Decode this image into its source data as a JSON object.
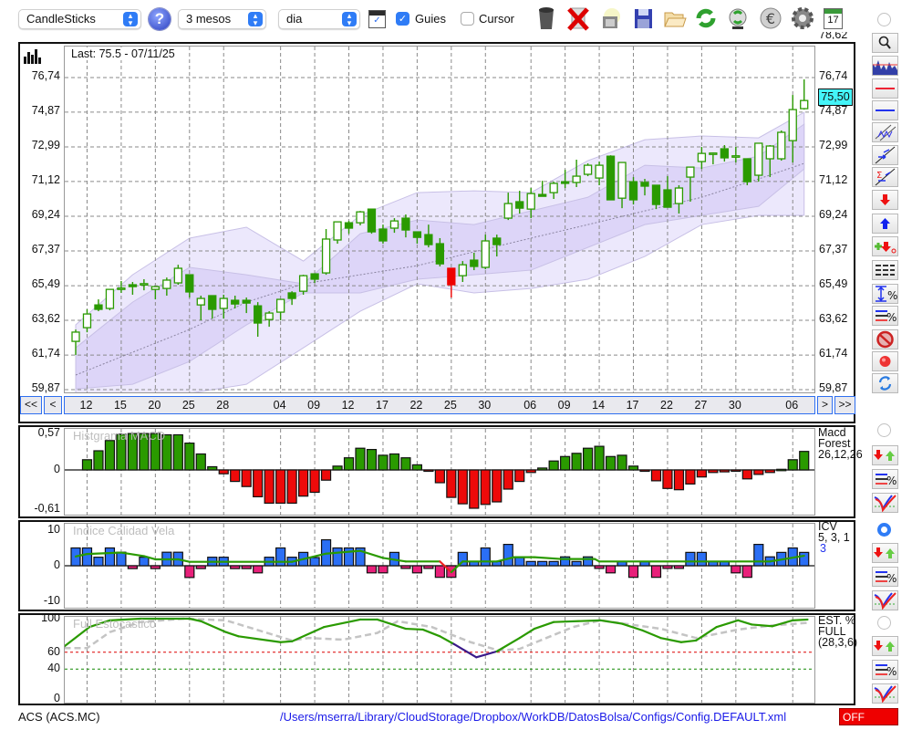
{
  "toolbar": {
    "chart_type": "CandleSticks",
    "period": "3 mesos",
    "interval": "dia",
    "guides_label": "Guies",
    "guides_checked": true,
    "cursor_label": "Cursor",
    "cursor_checked": false,
    "icons": [
      "help-icon",
      "chart-window-icon",
      "trash-icon",
      "delete-icon",
      "camera-icon",
      "save-icon",
      "open-folder-icon",
      "refresh-icon",
      "sync-icon",
      "euro-icon",
      "gear-icon",
      "calendar-icon"
    ],
    "calendar_day": "17"
  },
  "main_chart": {
    "last_label": "Last: 75.5 - 07/11/25",
    "last_price_tag": "75,50"
  },
  "navigation": {
    "first": "<<",
    "prev": "<",
    "next": ">",
    "last": ">>"
  },
  "panels": {
    "macd": {
      "title": "Histgrama MACD",
      "legend": [
        "Macd",
        "Forest",
        "26,12,26"
      ]
    },
    "icv": {
      "title": "Indice Calidad Vela",
      "legend": [
        "ICV",
        "5, 3, 1"
      ],
      "legend_value": "3"
    },
    "stoch": {
      "title": "Full Estocastico",
      "legend": [
        "EST. %",
        "FULL",
        "(28,3,6)"
      ]
    }
  },
  "status": {
    "symbol": "ACS (ACS.MC)",
    "config_path": "/Users/mserra/Library/CloudStorage/Dropbox/WorkDB/DatosBolsa/Configs/Config.DEFAULT.xml",
    "connection": "OFF"
  },
  "colors": {
    "candle": "#2a9a00",
    "candle_red": "#ee0000",
    "band_outer": "#ece8fc",
    "band_inner": "#ddd5f8",
    "macd_pos": "#2a9a00",
    "macd_neg": "#ee0a0a",
    "icv_pos": "#2b6ff5",
    "icv_neg": "#e8207a",
    "signal": "#2a9a00",
    "stoch_d": "#c4c4c4",
    "stoch_low": "#3a1a8a",
    "accent": "#2f7cf6",
    "price_tag": "#44f4f8"
  },
  "chart_data": [
    {
      "type": "candlestick",
      "ylim": [
        59.87,
        76.74
      ],
      "y_ticks": [
        {
          "label": "78,62",
          "value": 78.62
        },
        {
          "label": "76,74",
          "value": 76.74
        },
        {
          "label": "74,87",
          "value": 74.87
        },
        {
          "label": "72,99",
          "value": 72.99
        },
        {
          "label": "71,12",
          "value": 71.12
        },
        {
          "label": "69,24",
          "value": 69.24
        },
        {
          "label": "67,37",
          "value": 67.37
        },
        {
          "label": "65,49",
          "value": 65.49
        },
        {
          "label": "63,62",
          "value": 63.62
        },
        {
          "label": "61,74",
          "value": 61.74
        },
        {
          "label": "59,87",
          "value": 59.87
        }
      ],
      "x_ticks": [
        {
          "label": "12",
          "index": 1
        },
        {
          "label": "15",
          "index": 4
        },
        {
          "label": "20",
          "index": 7
        },
        {
          "label": "25",
          "index": 10
        },
        {
          "label": "28",
          "index": 13
        },
        {
          "label": "04",
          "index": 18
        },
        {
          "label": "09",
          "index": 21
        },
        {
          "label": "12",
          "index": 24
        },
        {
          "label": "17",
          "index": 27
        },
        {
          "label": "22",
          "index": 30
        },
        {
          "label": "25",
          "index": 33
        },
        {
          "label": "30",
          "index": 36
        },
        {
          "label": "06",
          "index": 40
        },
        {
          "label": "09",
          "index": 43
        },
        {
          "label": "14",
          "index": 46
        },
        {
          "label": "17",
          "index": 49
        },
        {
          "label": "22",
          "index": 52
        },
        {
          "label": "27",
          "index": 55
        },
        {
          "label": "30",
          "index": 58
        },
        {
          "label": "06",
          "index": 63
        }
      ],
      "ohlc": [
        [
          62.48,
          63.12,
          61.74,
          62.98
        ],
        [
          63.22,
          64.21,
          62.97,
          63.96
        ],
        [
          64.45,
          64.75,
          64.11,
          64.21
        ],
        [
          64.26,
          65.29,
          64.16,
          65.29
        ],
        [
          65.34,
          65.74,
          65.1,
          65.36
        ],
        [
          65.54,
          65.69,
          65.0,
          65.44
        ],
        [
          65.59,
          65.84,
          65.24,
          65.6
        ],
        [
          65.29,
          65.44,
          64.75,
          65.44
        ],
        [
          65.34,
          65.93,
          64.95,
          65.79
        ],
        [
          65.64,
          66.62,
          65.54,
          66.43
        ],
        [
          66.08,
          66.08,
          64.85,
          65.15
        ],
        [
          64.45,
          64.95,
          63.62,
          64.8
        ],
        [
          64.95,
          64.95,
          63.71,
          64.21
        ],
        [
          64.26,
          65.0,
          63.71,
          64.8
        ],
        [
          64.7,
          64.95,
          64.26,
          64.5
        ],
        [
          64.7,
          64.85,
          64.01,
          64.55
        ],
        [
          64.4,
          64.6,
          62.73,
          63.47
        ],
        [
          63.66,
          64.11,
          63.27,
          64.01
        ],
        [
          64.06,
          64.75,
          63.62,
          64.75
        ],
        [
          65.1,
          65.19,
          64.45,
          64.8
        ],
        [
          65.19,
          66.08,
          65.0,
          66.03
        ],
        [
          66.13,
          66.13,
          65.64,
          65.84
        ],
        [
          66.18,
          68.55,
          66.08,
          68.01
        ],
        [
          67.96,
          68.94,
          67.76,
          68.94
        ],
        [
          68.89,
          68.99,
          68.3,
          68.6
        ],
        [
          68.89,
          69.53,
          68.75,
          69.48
        ],
        [
          69.63,
          69.63,
          68.3,
          68.4
        ],
        [
          68.55,
          68.79,
          67.76,
          67.91
        ],
        [
          68.6,
          69.14,
          68.35,
          68.99
        ],
        [
          69.14,
          69.34,
          68.1,
          68.5
        ],
        [
          68.4,
          68.4,
          67.76,
          68.1
        ],
        [
          68.25,
          68.79,
          67.56,
          67.71
        ],
        [
          67.76,
          68.06,
          66.53,
          66.67
        ],
        [
          66.43,
          66.43,
          64.85,
          65.54
        ],
        [
          66.03,
          66.82,
          65.69,
          66.62
        ],
        [
          66.87,
          67.27,
          66.33,
          66.53
        ],
        [
          66.48,
          68.25,
          66.38,
          67.91
        ],
        [
          68.06,
          68.25,
          67.07,
          67.71
        ],
        [
          69.14,
          70.52,
          69.04,
          69.93
        ],
        [
          70.03,
          70.62,
          69.39,
          69.68
        ],
        [
          69.63,
          70.77,
          69.14,
          70.47
        ],
        [
          70.42,
          71.16,
          70.32,
          70.32
        ],
        [
          70.52,
          71.11,
          70.18,
          71.02
        ],
        [
          71.11,
          71.75,
          70.77,
          71.02
        ],
        [
          71.07,
          72.3,
          70.82,
          71.41
        ],
        [
          71.51,
          72.1,
          71.41,
          72.0
        ],
        [
          71.31,
          72.2,
          70.92,
          72.0
        ],
        [
          72.49,
          72.54,
          70.13,
          70.13
        ],
        [
          70.22,
          72.15,
          69.68,
          72.15
        ],
        [
          71.11,
          71.36,
          69.88,
          70.13
        ],
        [
          71.07,
          71.26,
          70.37,
          70.87
        ],
        [
          70.92,
          70.92,
          69.63,
          69.88
        ],
        [
          70.67,
          71.41,
          69.73,
          69.73
        ],
        [
          69.93,
          70.92,
          69.39,
          70.77
        ],
        [
          71.36,
          71.9,
          70.03,
          71.9
        ],
        [
          72.2,
          72.99,
          71.8,
          72.64
        ],
        [
          72.64,
          72.69,
          72.05,
          72.66
        ],
        [
          72.89,
          73.09,
          72.2,
          72.4
        ],
        [
          72.49,
          72.99,
          72.15,
          72.51
        ],
        [
          72.35,
          72.35,
          70.92,
          71.11
        ],
        [
          71.46,
          73.19,
          71.11,
          73.19
        ],
        [
          72.35,
          73.09,
          71.36,
          73.04
        ],
        [
          72.35,
          73.88,
          72.25,
          73.78
        ],
        [
          73.33,
          75.8,
          72.15,
          75.01
        ],
        [
          75.06,
          76.64,
          75.01,
          75.5
        ]
      ],
      "red_candles": [
        33
      ],
      "bands": {
        "index": [
          0,
          5,
          10,
          15,
          20,
          25,
          30,
          35,
          40,
          45,
          50,
          55,
          60,
          64
        ],
        "outer_upper": [
          63.37,
          66.08,
          68.06,
          68.65,
          66.82,
          69.29,
          70.52,
          70.62,
          70.52,
          72.25,
          73.38,
          73.58,
          73.48,
          74.86
        ],
        "inner_upper": [
          62.13,
          64.6,
          66.48,
          66.08,
          65.59,
          68.3,
          69.04,
          68.79,
          69.53,
          70.27,
          72.0,
          71.85,
          72.49,
          74.22
        ],
        "moving_average": [
          60.66,
          61.89,
          63.12,
          64.6,
          65.59,
          66.08,
          66.57,
          67.32,
          68.06,
          68.79,
          69.53,
          70.27,
          71.26,
          72.1
        ],
        "inner_lower": [
          59.91,
          60.16,
          61.39,
          63.37,
          65.1,
          65.1,
          65.84,
          66.08,
          66.33,
          67.56,
          68.79,
          69.29,
          69.78,
          71.8
        ],
        "outer_lower": [
          59.17,
          59.17,
          59.67,
          60.16,
          62.13,
          64.11,
          65.59,
          65.1,
          65.34,
          65.84,
          67.07,
          68.79,
          69.29,
          69.29
        ]
      },
      "last_price": 75.5
    },
    {
      "type": "bar",
      "title": "Histgrama MACD",
      "ylim": [
        -0.61,
        0.57
      ],
      "y_ticks": [
        {
          "label": "0,57",
          "value": 0.57
        },
        {
          "label": "0",
          "value": 0
        },
        {
          "label": "-0,61",
          "value": -0.61
        }
      ],
      "values": [
        0,
        0.16,
        0.3,
        0.46,
        0.56,
        0.57,
        0.57,
        0.57,
        0.55,
        0.55,
        0.42,
        0.25,
        0.05,
        -0.06,
        -0.18,
        -0.26,
        -0.42,
        -0.52,
        -0.52,
        -0.52,
        -0.41,
        -0.35,
        -0.16,
        0.06,
        0.19,
        0.34,
        0.32,
        0.23,
        0.25,
        0.19,
        0.08,
        -0.02,
        -0.2,
        -0.43,
        -0.53,
        -0.6,
        -0.54,
        -0.5,
        -0.3,
        -0.18,
        -0.04,
        0.03,
        0.14,
        0.21,
        0.26,
        0.34,
        0.37,
        0.21,
        0.23,
        0.06,
        -0.02,
        -0.17,
        -0.29,
        -0.31,
        -0.22,
        -0.11,
        -0.04,
        -0.03,
        -0.02,
        -0.14,
        -0.07,
        -0.04,
        0.01,
        0.16,
        0.29
      ]
    },
    {
      "type": "bar",
      "title": "Indice Calidad Vela",
      "ylim": [
        -10,
        10
      ],
      "y_ticks": [
        {
          "label": "10",
          "value": 10
        },
        {
          "label": "0",
          "value": 0
        },
        {
          "label": "-10",
          "value": -10
        }
      ],
      "values": [
        5,
        5,
        2.4,
        5,
        3.8,
        -0.8,
        2.4,
        -0.8,
        3.8,
        3.8,
        -3.3,
        -0.8,
        2.4,
        2.4,
        -0.8,
        -0.8,
        -2,
        2.4,
        5,
        2.4,
        3.75,
        2.3,
        7.3,
        5,
        5,
        5,
        -2,
        -2,
        3.75,
        -0.75,
        -2,
        -0.75,
        -3.25,
        -3.25,
        3.75,
        1.2,
        5,
        1.2,
        6,
        2.3,
        1.2,
        1.2,
        1.2,
        2.5,
        1.2,
        2.5,
        -0.75,
        -2,
        1.2,
        -3.25,
        1.2,
        -3.25,
        -0.75,
        -0.75,
        3.75,
        3.75,
        1.2,
        1.2,
        -2,
        -3.25,
        6,
        2.5,
        3.75,
        5,
        3.75
      ],
      "signal": [
        [
          0,
          2.6
        ],
        [
          1,
          3.3
        ],
        [
          4,
          3.7
        ],
        [
          6,
          2.7
        ],
        [
          7,
          1.8
        ],
        [
          9,
          1.8
        ],
        [
          10,
          1.1
        ],
        [
          19,
          1.1
        ],
        [
          22,
          3.4
        ],
        [
          25,
          4.2
        ],
        [
          27,
          2.2
        ],
        [
          29,
          1.2
        ],
        [
          32,
          1.2
        ],
        [
          33,
          -1.8
        ],
        [
          34,
          1.2
        ],
        [
          37,
          1.2
        ],
        [
          38.5,
          2.4
        ],
        [
          40.3,
          2.4
        ],
        [
          42.6,
          1.9
        ],
        [
          45.6,
          1.9
        ],
        [
          46,
          1.2
        ],
        [
          61,
          1.2
        ],
        [
          64,
          2.8
        ]
      ],
      "signal_red_segment": [
        32,
        33
      ]
    },
    {
      "type": "line",
      "title": "Full Estocastico",
      "ylim": [
        0,
        100
      ],
      "y_ticks": [
        {
          "label": "100",
          "value": 100
        },
        {
          "label": "60",
          "value": 60
        },
        {
          "label": "40",
          "value": 40
        },
        {
          "label": "0",
          "value": 0
        }
      ],
      "reference_lines": [
        {
          "value": 60,
          "color": "#dd0000"
        },
        {
          "value": 40,
          "color": "#118800"
        }
      ],
      "series": [
        {
          "name": "%K",
          "points": [
            [
              -1,
              67
            ],
            [
              1.2,
              90
            ],
            [
              3,
              98
            ],
            [
              5.7,
              100
            ],
            [
              10,
              100
            ],
            [
              11,
              97
            ],
            [
              13.2,
              84
            ],
            [
              14.3,
              79
            ],
            [
              18,
              72
            ],
            [
              19,
              73
            ],
            [
              21.8,
              90
            ],
            [
              25,
              99
            ],
            [
              26.5,
              99
            ],
            [
              29,
              88
            ],
            [
              30.5,
              87
            ],
            [
              32,
              79
            ],
            [
              33.2,
              70
            ],
            [
              35.2,
              54
            ],
            [
              37,
              61
            ],
            [
              39,
              77
            ],
            [
              40.3,
              88
            ],
            [
              42,
              96
            ],
            [
              46.1,
              98
            ],
            [
              48,
              94
            ],
            [
              49.8,
              86
            ],
            [
              51.4,
              77
            ],
            [
              53.2,
              72
            ],
            [
              54.5,
              74
            ],
            [
              56.3,
              90
            ],
            [
              58.2,
              98
            ],
            [
              59.4,
              93
            ],
            [
              61.2,
              91
            ],
            [
              63,
              98
            ],
            [
              64.3,
              99
            ]
          ],
          "low_segment": [
            33.2,
            37
          ]
        },
        {
          "name": "%D",
          "points": [
            [
              -1,
              65
            ],
            [
              1,
              65
            ],
            [
              3,
              84
            ],
            [
              5.7,
              96
            ],
            [
              9.5,
              100
            ],
            [
              13.2,
              98
            ],
            [
              19,
              74
            ],
            [
              20.5,
              77
            ],
            [
              23.5,
              75
            ],
            [
              26.5,
              83
            ],
            [
              28.3,
              97
            ],
            [
              31.3,
              90
            ],
            [
              34.7,
              72
            ],
            [
              37.2,
              62
            ],
            [
              39,
              64
            ],
            [
              43.7,
              90
            ],
            [
              46.1,
              98
            ],
            [
              51.4,
              88
            ],
            [
              54.5,
              77
            ],
            [
              58.2,
              87
            ],
            [
              61.2,
              92
            ],
            [
              64.3,
              95
            ]
          ]
        }
      ]
    }
  ]
}
